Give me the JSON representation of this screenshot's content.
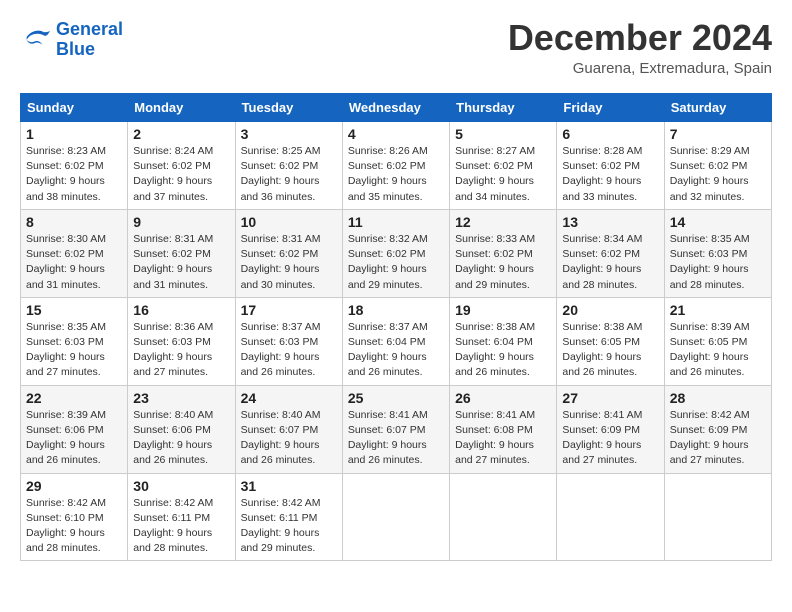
{
  "header": {
    "logo_line1": "General",
    "logo_line2": "Blue",
    "month_title": "December 2024",
    "location": "Guarena, Extremadura, Spain"
  },
  "weekdays": [
    "Sunday",
    "Monday",
    "Tuesday",
    "Wednesday",
    "Thursday",
    "Friday",
    "Saturday"
  ],
  "weeks": [
    [
      {
        "day": "1",
        "sunrise": "8:23 AM",
        "sunset": "6:02 PM",
        "daylight": "9 hours and 38 minutes."
      },
      {
        "day": "2",
        "sunrise": "8:24 AM",
        "sunset": "6:02 PM",
        "daylight": "9 hours and 37 minutes."
      },
      {
        "day": "3",
        "sunrise": "8:25 AM",
        "sunset": "6:02 PM",
        "daylight": "9 hours and 36 minutes."
      },
      {
        "day": "4",
        "sunrise": "8:26 AM",
        "sunset": "6:02 PM",
        "daylight": "9 hours and 35 minutes."
      },
      {
        "day": "5",
        "sunrise": "8:27 AM",
        "sunset": "6:02 PM",
        "daylight": "9 hours and 34 minutes."
      },
      {
        "day": "6",
        "sunrise": "8:28 AM",
        "sunset": "6:02 PM",
        "daylight": "9 hours and 33 minutes."
      },
      {
        "day": "7",
        "sunrise": "8:29 AM",
        "sunset": "6:02 PM",
        "daylight": "9 hours and 32 minutes."
      }
    ],
    [
      {
        "day": "8",
        "sunrise": "8:30 AM",
        "sunset": "6:02 PM",
        "daylight": "9 hours and 31 minutes."
      },
      {
        "day": "9",
        "sunrise": "8:31 AM",
        "sunset": "6:02 PM",
        "daylight": "9 hours and 31 minutes."
      },
      {
        "day": "10",
        "sunrise": "8:31 AM",
        "sunset": "6:02 PM",
        "daylight": "9 hours and 30 minutes."
      },
      {
        "day": "11",
        "sunrise": "8:32 AM",
        "sunset": "6:02 PM",
        "daylight": "9 hours and 29 minutes."
      },
      {
        "day": "12",
        "sunrise": "8:33 AM",
        "sunset": "6:02 PM",
        "daylight": "9 hours and 29 minutes."
      },
      {
        "day": "13",
        "sunrise": "8:34 AM",
        "sunset": "6:02 PM",
        "daylight": "9 hours and 28 minutes."
      },
      {
        "day": "14",
        "sunrise": "8:35 AM",
        "sunset": "6:03 PM",
        "daylight": "9 hours and 28 minutes."
      }
    ],
    [
      {
        "day": "15",
        "sunrise": "8:35 AM",
        "sunset": "6:03 PM",
        "daylight": "9 hours and 27 minutes."
      },
      {
        "day": "16",
        "sunrise": "8:36 AM",
        "sunset": "6:03 PM",
        "daylight": "9 hours and 27 minutes."
      },
      {
        "day": "17",
        "sunrise": "8:37 AM",
        "sunset": "6:03 PM",
        "daylight": "9 hours and 26 minutes."
      },
      {
        "day": "18",
        "sunrise": "8:37 AM",
        "sunset": "6:04 PM",
        "daylight": "9 hours and 26 minutes."
      },
      {
        "day": "19",
        "sunrise": "8:38 AM",
        "sunset": "6:04 PM",
        "daylight": "9 hours and 26 minutes."
      },
      {
        "day": "20",
        "sunrise": "8:38 AM",
        "sunset": "6:05 PM",
        "daylight": "9 hours and 26 minutes."
      },
      {
        "day": "21",
        "sunrise": "8:39 AM",
        "sunset": "6:05 PM",
        "daylight": "9 hours and 26 minutes."
      }
    ],
    [
      {
        "day": "22",
        "sunrise": "8:39 AM",
        "sunset": "6:06 PM",
        "daylight": "9 hours and 26 minutes."
      },
      {
        "day": "23",
        "sunrise": "8:40 AM",
        "sunset": "6:06 PM",
        "daylight": "9 hours and 26 minutes."
      },
      {
        "day": "24",
        "sunrise": "8:40 AM",
        "sunset": "6:07 PM",
        "daylight": "9 hours and 26 minutes."
      },
      {
        "day": "25",
        "sunrise": "8:41 AM",
        "sunset": "6:07 PM",
        "daylight": "9 hours and 26 minutes."
      },
      {
        "day": "26",
        "sunrise": "8:41 AM",
        "sunset": "6:08 PM",
        "daylight": "9 hours and 27 minutes."
      },
      {
        "day": "27",
        "sunrise": "8:41 AM",
        "sunset": "6:09 PM",
        "daylight": "9 hours and 27 minutes."
      },
      {
        "day": "28",
        "sunrise": "8:42 AM",
        "sunset": "6:09 PM",
        "daylight": "9 hours and 27 minutes."
      }
    ],
    [
      {
        "day": "29",
        "sunrise": "8:42 AM",
        "sunset": "6:10 PM",
        "daylight": "9 hours and 28 minutes."
      },
      {
        "day": "30",
        "sunrise": "8:42 AM",
        "sunset": "6:11 PM",
        "daylight": "9 hours and 28 minutes."
      },
      {
        "day": "31",
        "sunrise": "8:42 AM",
        "sunset": "6:11 PM",
        "daylight": "9 hours and 29 minutes."
      },
      null,
      null,
      null,
      null
    ]
  ],
  "labels": {
    "sunrise": "Sunrise:",
    "sunset": "Sunset:",
    "daylight": "Daylight hours"
  }
}
